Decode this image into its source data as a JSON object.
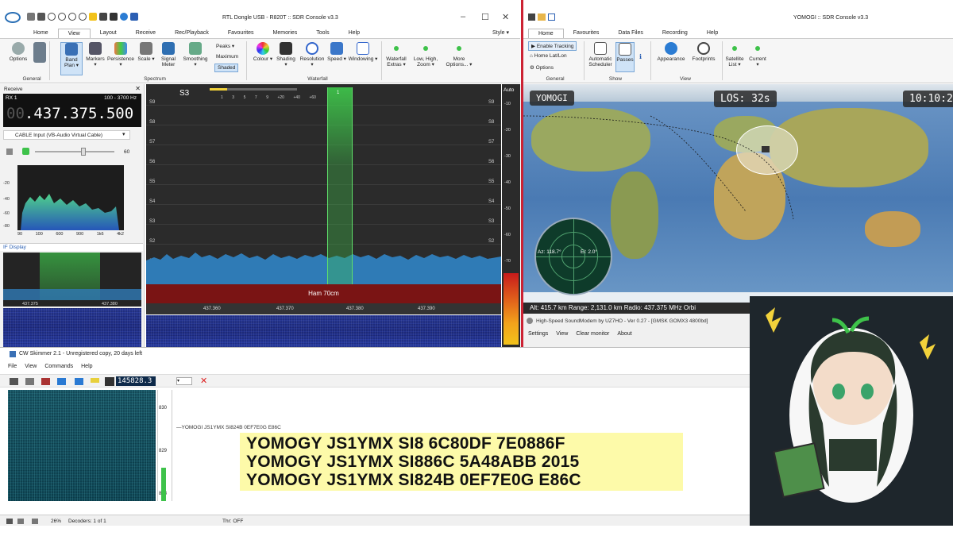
{
  "sdr": {
    "title": "RTL Dongle USB - R820T :: SDR Console v3.3",
    "tabs": [
      "Home",
      "View",
      "Layout",
      "Receive",
      "Rec/Playback",
      "Favourites",
      "Memories",
      "Tools",
      "Help"
    ],
    "active_tab": "View",
    "style_label": "Style",
    "ribbon": {
      "options": "Options",
      "band_plan": "Band Plan",
      "markers": "Markers",
      "persistence": "Persistence",
      "scale": "Scale",
      "signal_meter": "Signal Meter",
      "smoothing": "Smoothing",
      "peaks": "Peaks",
      "maximum": "Maximum",
      "shaded": "Shaded",
      "colour": "Colour",
      "shading": "Shading",
      "resolution": "Resolution",
      "speed": "Speed",
      "windowing": "Windowing",
      "waterfall_extras": "Waterfall Extras",
      "low_high_zoom": "Low, High, Zoom",
      "more_options": "More Options...",
      "group_general": "General",
      "group_spectrum": "Spectrum",
      "group_waterfall": "Waterfall"
    },
    "receive": {
      "panel_title": "Receive",
      "rx_label": "RX 1",
      "bandwidth": "100 - 3700 Hz",
      "freq_dim": "00",
      "freq_main": ".437.375.500",
      "input_select": "CABLE Input (VB-Audio Virtual Cable)",
      "volume": "60",
      "mini_y_ticks": [
        "-20",
        "-40",
        "-60",
        "-80"
      ],
      "mini_x_ticks": [
        "90",
        "100",
        "600",
        "900",
        "1k6",
        "4k2"
      ],
      "if_title": "IF Display",
      "if_ticks": [
        "437.375",
        "437.380"
      ]
    },
    "spectrum": {
      "smeter": "S3",
      "scale_marks": [
        "1",
        "3",
        "5",
        "7",
        "9",
        "+20",
        "+40",
        "+60"
      ],
      "s_levels": [
        "S9",
        "S8",
        "S7",
        "S6",
        "S5",
        "S4",
        "S3",
        "S2",
        "S1",
        "S0"
      ],
      "channel": "1",
      "band_label": "Ham 70cm",
      "freq_ticks": [
        "437.360",
        "437.370",
        "437.380",
        "437.390"
      ],
      "auto_label": "Auto",
      "db_ticks": [
        "-10",
        "-20",
        "-30",
        "-40",
        "-50",
        "-60",
        "-70",
        "-80",
        "-90"
      ]
    }
  },
  "yomogi": {
    "title": "YOMOGI :: SDR Console v3.3",
    "tabs": [
      "Home",
      "Favourites",
      "Data Files",
      "Recording",
      "Help"
    ],
    "ribbon": {
      "enable_tracking": "Enable Tracking",
      "home_latlon": "Home Lat/Lon",
      "options": "Options",
      "automatic_scheduler": "Automatic Scheduler",
      "passes": "Passes",
      "appearance": "Appearance",
      "footprints": "Footprints",
      "satellite_list": "Satellite List",
      "current": "Current",
      "group_general": "General",
      "group_show": "Show",
      "group_view": "View"
    },
    "map": {
      "sat_name": "YOMOGI",
      "los": "LOS: 32s",
      "clock": "10:10:29",
      "az": "Az: 118.7°",
      "el": "El: 2.0°",
      "status": "Alt: 415.7 km   Range: 2,131.0 km   Radio: 437.375 MHz  Orbi"
    }
  },
  "soundmodem": {
    "title": "High-Speed SoundModem by UZ7HO - Ver 0.27 - [GMSK GOMX3 4800bd]",
    "menu": [
      "Settings",
      "View",
      "Clear monitor",
      "About"
    ]
  },
  "cw": {
    "title": "CW Skimmer 2.1 - Unregistered copy, 20 days left",
    "menu": [
      "File",
      "View",
      "Commands",
      "Help"
    ],
    "freq": "145828.3",
    "scale": [
      "830",
      "829",
      "828"
    ],
    "raw_line": "—YOMOGI JS1YMX SI824B 0EF7E0G E86C",
    "decoded": [
      "YOMOGY JS1YMX SI8 6C80DF 7E0886F",
      "YOMOGY JS1YMX SI886C 5A48ABB 2015",
      "YOMOGY JS1YMX SI824B 0EF7E0G E86C"
    ],
    "status": {
      "percent": "26%",
      "decoders": "Decoders: 1 of 1",
      "thr": "Thr: OFF"
    }
  },
  "colors": {
    "accent_green": "#3ec24a",
    "spectrum_fill": "#2f7bb6",
    "band_red": "#7a1414",
    "highlight_yellow": "#fdfaa9"
  }
}
